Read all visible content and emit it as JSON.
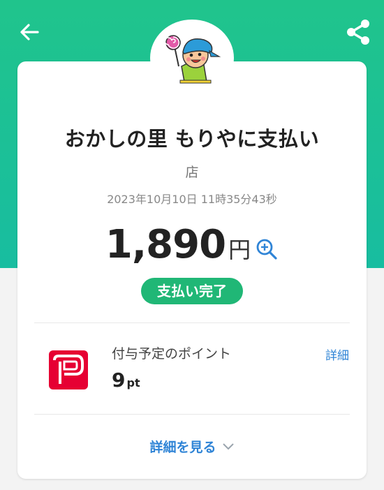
{
  "merchant": {
    "name": "おかしの里 もりやに支払い",
    "store_suffix": "店",
    "datetime": "2023年10月10日 11時35分43秒"
  },
  "payment": {
    "amount": "1,890",
    "currency": "円",
    "status": "支払い完了"
  },
  "points": {
    "title": "付与予定のポイント",
    "value": "9",
    "unit": "pt",
    "detail_link": "詳細"
  },
  "footer": {
    "see_more": "詳細を見る"
  },
  "icons": {
    "back": "back-arrow-icon",
    "share": "share-icon",
    "zoom": "zoom-in-icon",
    "chevron": "chevron-down-icon"
  },
  "colors": {
    "header": "#20c48c",
    "status": "#20b776",
    "link": "#2f84d6",
    "brand": "#e60033"
  }
}
